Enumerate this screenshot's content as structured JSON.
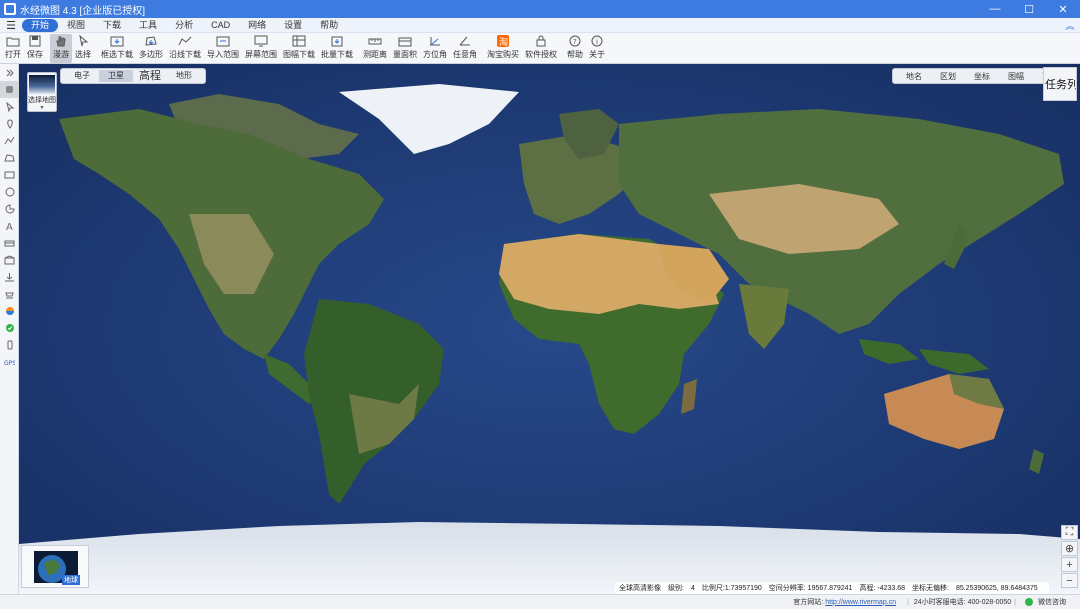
{
  "window": {
    "title": "水经微图 4.3 [企业版已授权]",
    "minimize": "—",
    "maximize": "☐",
    "close": "✕"
  },
  "menu": {
    "items": [
      "开始",
      "视图",
      "下载",
      "工具",
      "分析",
      "CAD",
      "网络",
      "设置",
      "帮助"
    ],
    "active_index": 0,
    "collapse": "︽"
  },
  "toolbar": {
    "items": [
      {
        "label": "打开",
        "icon": "folder-icon"
      },
      {
        "label": "保存",
        "icon": "save-icon"
      },
      {
        "label": "漫游",
        "icon": "hand-icon",
        "active": true
      },
      {
        "label": "选择",
        "icon": "cursor-icon"
      },
      {
        "label": "框选下载",
        "icon": "box-download-icon"
      },
      {
        "label": "多边形",
        "icon": "polygon-icon"
      },
      {
        "label": "沿线下载",
        "icon": "line-download-icon"
      },
      {
        "label": "导入范围",
        "icon": "import-range-icon"
      },
      {
        "label": "屏幕范围",
        "icon": "screen-range-icon"
      },
      {
        "label": "图幅下载",
        "icon": "sheet-download-icon"
      },
      {
        "label": "批量下载",
        "icon": "batch-download-icon"
      },
      {
        "label": "测距离",
        "icon": "measure-distance-icon"
      },
      {
        "label": "量面积",
        "icon": "measure-area-icon"
      },
      {
        "label": "方位角",
        "icon": "azimuth-icon"
      },
      {
        "label": "任意角",
        "icon": "any-angle-icon"
      },
      {
        "label": "淘宝购买",
        "icon": "taobao-icon"
      },
      {
        "label": "软件授权",
        "icon": "lock-icon"
      },
      {
        "label": "帮助",
        "icon": "help-icon"
      },
      {
        "label": "关于",
        "icon": "info-icon"
      }
    ],
    "accent": "#2f6fd6",
    "taobao_color": "#ff6a00"
  },
  "map": {
    "thumb_label": "选择地图",
    "layer_tabs": [
      "电子",
      "卫星",
      "高程",
      "地形"
    ],
    "selected_layer_index": 1,
    "overlay_tabs": [
      "地名",
      "区划",
      "坐标",
      "图幅",
      "瓦片"
    ],
    "task_list_label": "任务列表",
    "globe_label": "地球",
    "zoom_buttons": [
      {
        "name": "fullscreen-icon",
        "glyph": "⛶"
      },
      {
        "name": "locate-icon",
        "glyph": "⊕"
      },
      {
        "name": "zoom-in-icon",
        "glyph": "+"
      },
      {
        "name": "zoom-out-icon",
        "glyph": "−"
      }
    ],
    "status": {
      "source": "全球高清影像",
      "level_label": "级别:",
      "level": "4",
      "scale": "比例尺:1:73957190",
      "resolution": "空间分辨率: 19567.879241",
      "elevation": "高程: -4233.68",
      "offset": "坐标无偏移:",
      "coords": "85.2539062​5, 89.6484375"
    }
  },
  "footer": {
    "site_label": "官方网站:",
    "site_url": "http://www.rivermap.cn",
    "hotline": "24小时客服电话: 400-028-0050",
    "wechat": "微信咨询"
  },
  "colors": {
    "titlebar": "#3d7be0",
    "ocean": "#1f3f7e",
    "land_green": "#4a6a35",
    "desert": "#c9995a",
    "ice": "#e8edf4"
  }
}
